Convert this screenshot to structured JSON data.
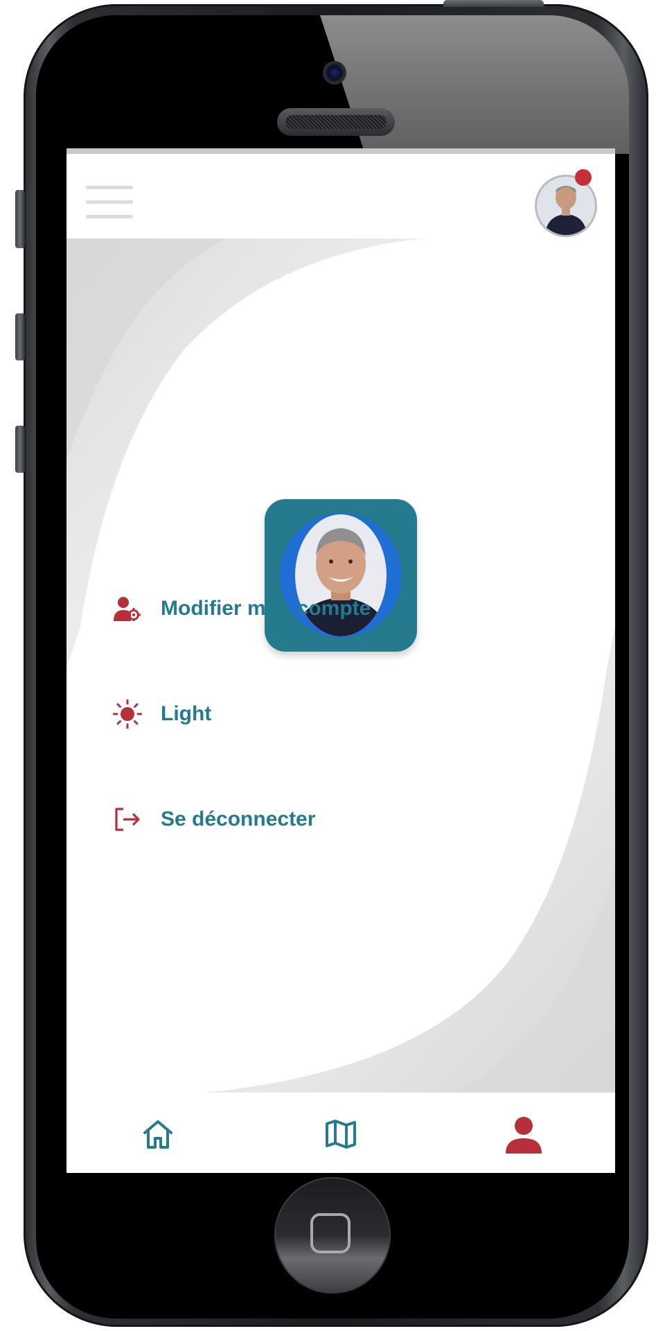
{
  "app": {
    "accent_color": "#257a8e",
    "icon_color": "#b5303b",
    "notification_color": "#c62f3a"
  },
  "header": {
    "menu_icon": "hamburger-icon",
    "avatar": "user-avatar-photo",
    "has_notification": true
  },
  "profile": {
    "photo": "user-profile-photo"
  },
  "menu": {
    "items": [
      {
        "icon": "user-settings-icon",
        "label": "Modifier mon compte"
      },
      {
        "icon": "sun-icon",
        "label": "Light"
      },
      {
        "icon": "logout-icon",
        "label": "Se déconnecter"
      }
    ]
  },
  "bottom_nav": {
    "items": [
      {
        "icon": "home-icon",
        "active": false
      },
      {
        "icon": "map-icon",
        "active": false
      },
      {
        "icon": "user-icon",
        "active": true
      }
    ]
  }
}
